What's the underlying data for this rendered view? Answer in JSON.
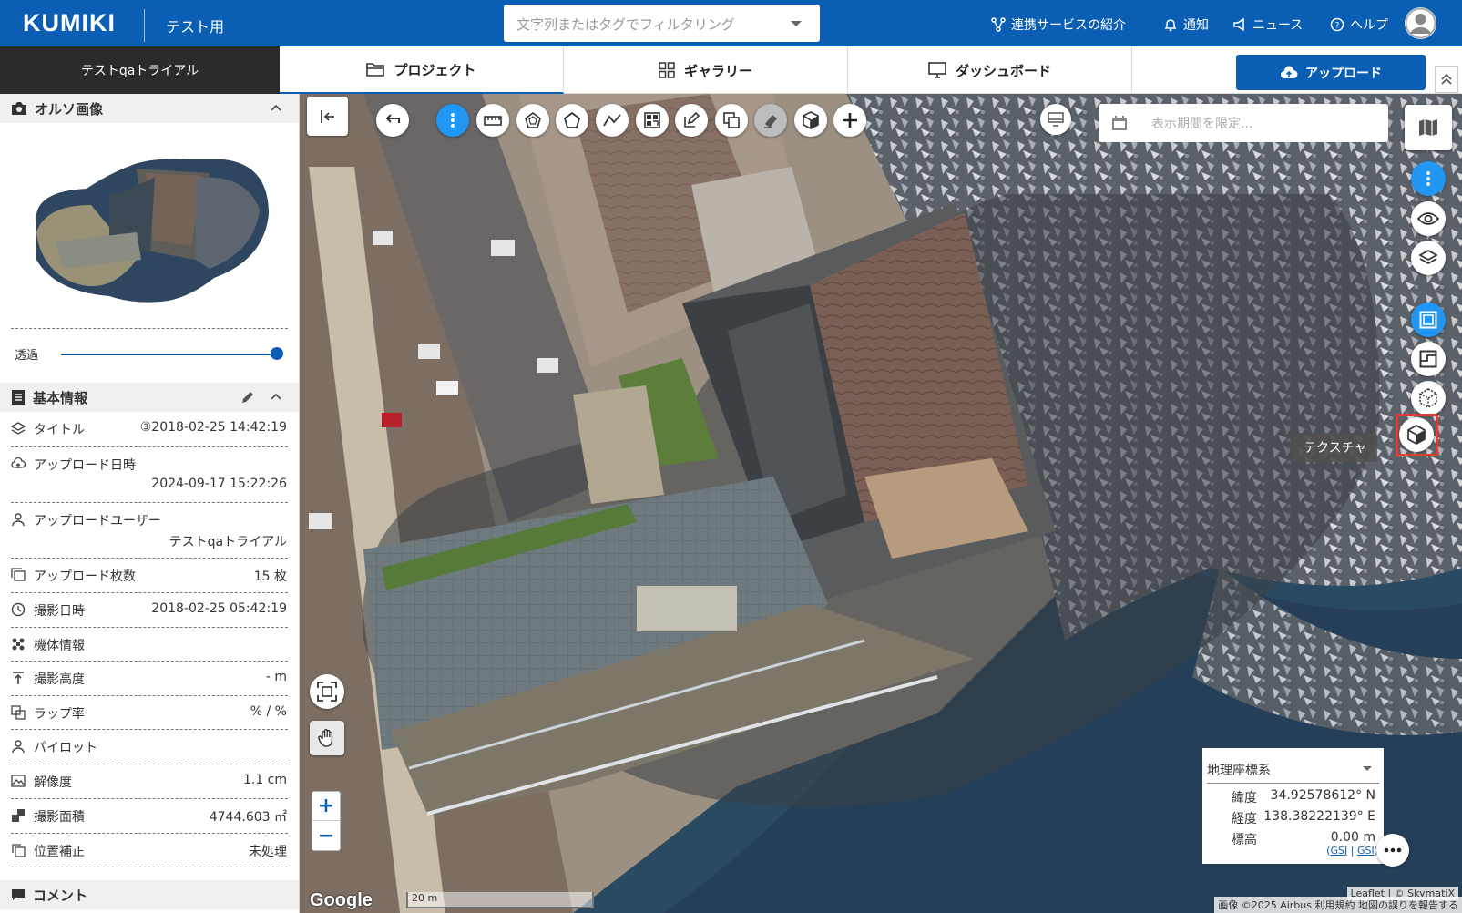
{
  "header": {
    "logo": "KUMIKI",
    "workspace": "テスト用",
    "search_placeholder": "文字列またはタグでフィルタリング",
    "nav": {
      "services": "連携サービスの紹介",
      "notifications": "通知",
      "news": "ニュース",
      "help": "ヘルプ"
    }
  },
  "subbar": {
    "user": "テストqaトライアル",
    "tabs": {
      "project": "プロジェクト",
      "gallery": "ギャラリー",
      "dashboard": "ダッシュボード"
    },
    "upload": "アップロード"
  },
  "sidebar": {
    "ortho": {
      "title": "オルソ画像",
      "opacity_label": "透過",
      "opacity": 1.0
    },
    "basic": {
      "title": "基本情報",
      "rows": {
        "title": {
          "label": "タイトル",
          "value": "③2018-02-25 14:42:19"
        },
        "upload_date": {
          "label": "アップロード日時",
          "value": "2024-09-17 15:22:26"
        },
        "upload_user": {
          "label": "アップロードユーザー",
          "value": "テストqaトライアル"
        },
        "upload_count": {
          "label": "アップロード枚数",
          "value": "15 枚"
        },
        "shot_date": {
          "label": "撮影日時",
          "value": "2018-02-25 05:42:19"
        },
        "aircraft": {
          "label": "機体情報",
          "value": ""
        },
        "altitude": {
          "label": "撮影高度",
          "value": "- m"
        },
        "overlap": {
          "label": "ラップ率",
          "value": "% / %"
        },
        "pilot": {
          "label": "パイロット",
          "value": ""
        },
        "resolution": {
          "label": "解像度",
          "value": "1.1 cm"
        },
        "area": {
          "label": "撮影面積",
          "value": "4744.603 ㎡"
        },
        "correction": {
          "label": "位置補正",
          "value": "未処理"
        }
      }
    },
    "comment": {
      "title": "コメント"
    }
  },
  "map": {
    "date_placeholder": "表示期間を限定...",
    "tooltip": "テクスチャ",
    "coord": {
      "system": "地理座標系",
      "lat_label": "緯度",
      "lat": "34.92578612° N",
      "lng_label": "経度",
      "lng": "138.38222139° E",
      "alt_label": "標高",
      "alt": "0.00 m",
      "link1": "GSJ",
      "link2": "GSI"
    },
    "zoom_in": "+",
    "zoom_out": "−",
    "scale": "20 m",
    "google": "Google",
    "attribution": "Leaflet | © SkymatiX",
    "attribution2": "画像 ©2025 Airbus  利用規約  地図の誤りを報告する"
  },
  "colors": {
    "brand": "#0a5fb4",
    "active_tool": "#2196f3",
    "highlight": "#e53935"
  }
}
